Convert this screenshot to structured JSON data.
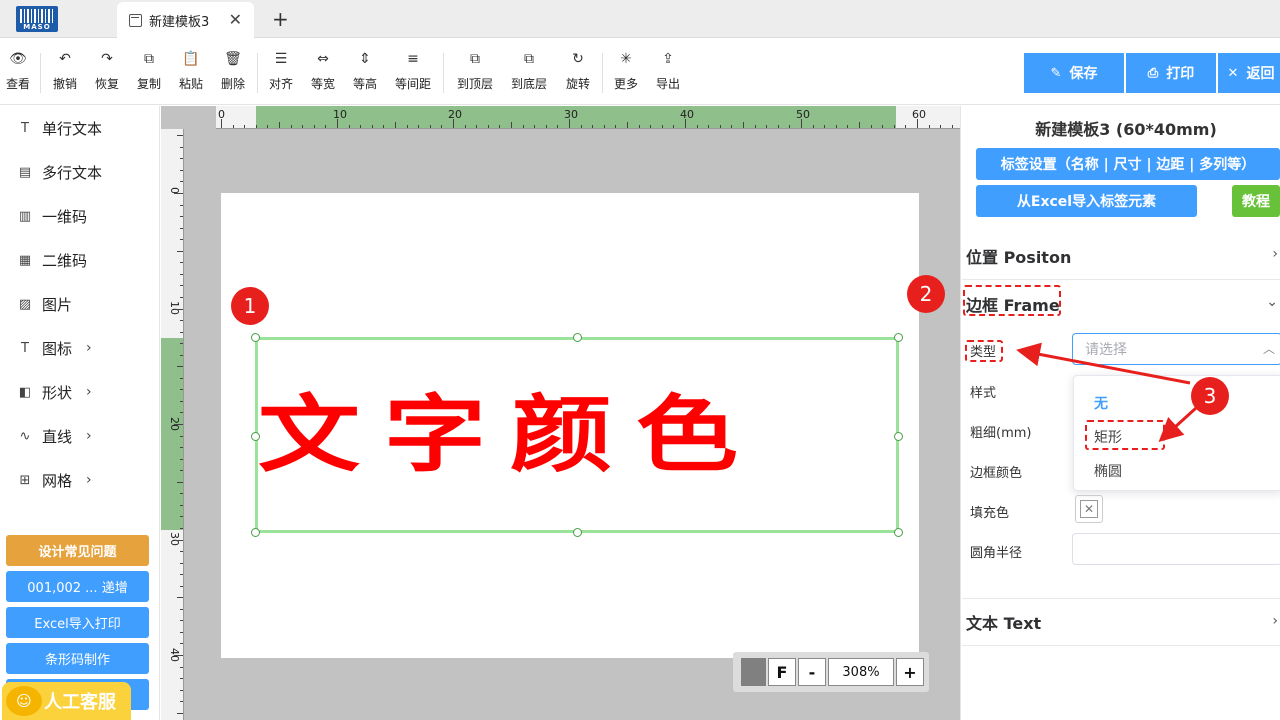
{
  "tab": {
    "title": "新建模板3",
    "close": "✕",
    "new": "+"
  },
  "logo": {
    "text": "MASO"
  },
  "toolbar": {
    "items": [
      {
        "label": "查看",
        "icon": "👁"
      },
      {
        "label": "撤销",
        "icon": "↶"
      },
      {
        "label": "恢复",
        "icon": "↷"
      },
      {
        "label": "复制",
        "icon": "⧉"
      },
      {
        "label": "粘贴",
        "icon": "📋"
      },
      {
        "label": "删除",
        "icon": "🗑"
      },
      {
        "label": "对齐",
        "icon": "☰"
      },
      {
        "label": "等宽",
        "icon": "⇔"
      },
      {
        "label": "等高",
        "icon": "⇕"
      },
      {
        "label": "等间距",
        "icon": "≡"
      },
      {
        "label": "到顶层",
        "icon": "⧉"
      },
      {
        "label": "到底层",
        "icon": "⧉"
      },
      {
        "label": "旋转",
        "icon": "↻"
      },
      {
        "label": "更多",
        "icon": "✳"
      },
      {
        "label": "导出",
        "icon": "⇪"
      }
    ],
    "save": "保存",
    "print": "打印",
    "back": "返回"
  },
  "sidebar": {
    "items": [
      {
        "label": "单行文本",
        "icon": "T"
      },
      {
        "label": "多行文本",
        "icon": "▤"
      },
      {
        "label": "一维码",
        "icon": "▥"
      },
      {
        "label": "二维码",
        "icon": "▦"
      },
      {
        "label": "图片",
        "icon": "▨"
      },
      {
        "label": "图标",
        "icon": "T"
      },
      {
        "label": "形状",
        "icon": "◧"
      },
      {
        "label": "直线",
        "icon": "∿"
      },
      {
        "label": "网格",
        "icon": "⊞"
      }
    ],
    "chevron": "›",
    "buttons": [
      "设计常见问题",
      "001,002 ... 递增",
      "Excel导入打印",
      "条形码制作"
    ],
    "kefu": "人工客服"
  },
  "canvas": {
    "text": "文字颜色",
    "ruler_top": [
      "0",
      "10",
      "20",
      "30",
      "40",
      "50",
      "60"
    ],
    "ruler_left": [
      "0",
      "10",
      "20",
      "30",
      "40"
    ],
    "zoom": {
      "fit": "F",
      "minus": "-",
      "level": "308%",
      "plus": "+"
    }
  },
  "panel": {
    "title": "新建模板3 (60*40mm)",
    "label_settings": "标签设置（名称 | 尺寸 | 边距 | 多列等）",
    "import_excel": "从Excel导入标签元素",
    "tutorial": "教程",
    "sections": {
      "position": "位置 Positon",
      "frame": "边框 Frame",
      "text": "文本 Text"
    },
    "fields": {
      "type": "类型",
      "style": "样式",
      "thickness": "粗细(mm)",
      "border_color": "边框颜色",
      "fill_color": "填充色",
      "radius": "圆角半径"
    },
    "select_placeholder": "请选择",
    "options": [
      "无",
      "矩形",
      "椭圆"
    ]
  },
  "annotations": [
    "1",
    "2",
    "3"
  ],
  "colors": {
    "accent": "#409eff",
    "warning": "#e6a23c",
    "success": "#67c23a",
    "annotation": "#e8201d",
    "text_red": "#ff0000"
  }
}
